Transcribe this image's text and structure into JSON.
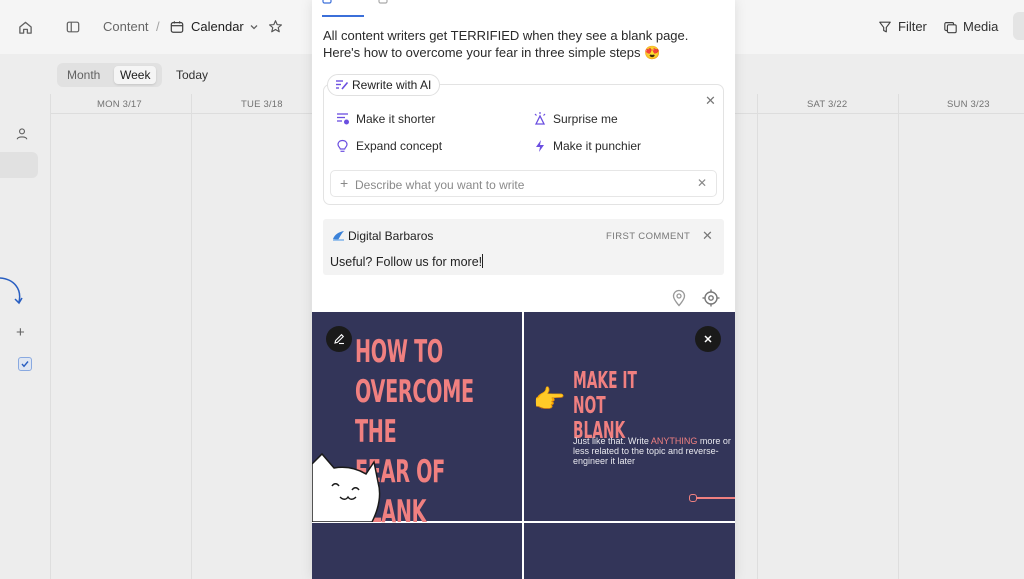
{
  "topbar": {
    "breadcrumb_root": "Content",
    "separator": "/",
    "view_name": "Calendar",
    "filter_label": "Filter",
    "media_label": "Media"
  },
  "view_switcher": {
    "month_label": "Month",
    "week_label": "Week",
    "active": "Week",
    "today_label": "Today"
  },
  "calendar": {
    "days": [
      "MON 3/17",
      "TUE 3/18",
      "SAT 3/22",
      "SUN 3/23"
    ]
  },
  "composer": {
    "caption": "All content writers get TERRIFIED when they see a blank page. Here's how to overcome your fear in three simple steps 😍",
    "ai": {
      "chip_label": "Rewrite with AI",
      "options": {
        "shorter": "Make it shorter",
        "surprise": "Surprise me",
        "expand": "Expand concept",
        "punchier": "Make it punchier"
      },
      "input_placeholder": "Describe what you want to write"
    },
    "first_comment": {
      "account_name": "Digital Barbaros",
      "tag": "FIRST COMMENT",
      "text": "Useful? Follow us for more!"
    }
  },
  "carousel": {
    "slide1_title": "HOW TO\nOVERCOME\nTHE FEAR OF\nBLANK PAGE",
    "slide2_title": "MAKE IT NOT\nBLANK",
    "slide2_body_before": "Just like that. Write ",
    "slide2_body_highlight": "ANYTHING",
    "slide2_body_after": " more or less related to the topic and reverse-engineer it later",
    "slide2_emoji": "👉"
  },
  "colors": {
    "accent_blue": "#3b6fd9",
    "ai_purple": "#6b4fe0",
    "slide_bg": "#333559",
    "slide_text": "#f08080"
  }
}
